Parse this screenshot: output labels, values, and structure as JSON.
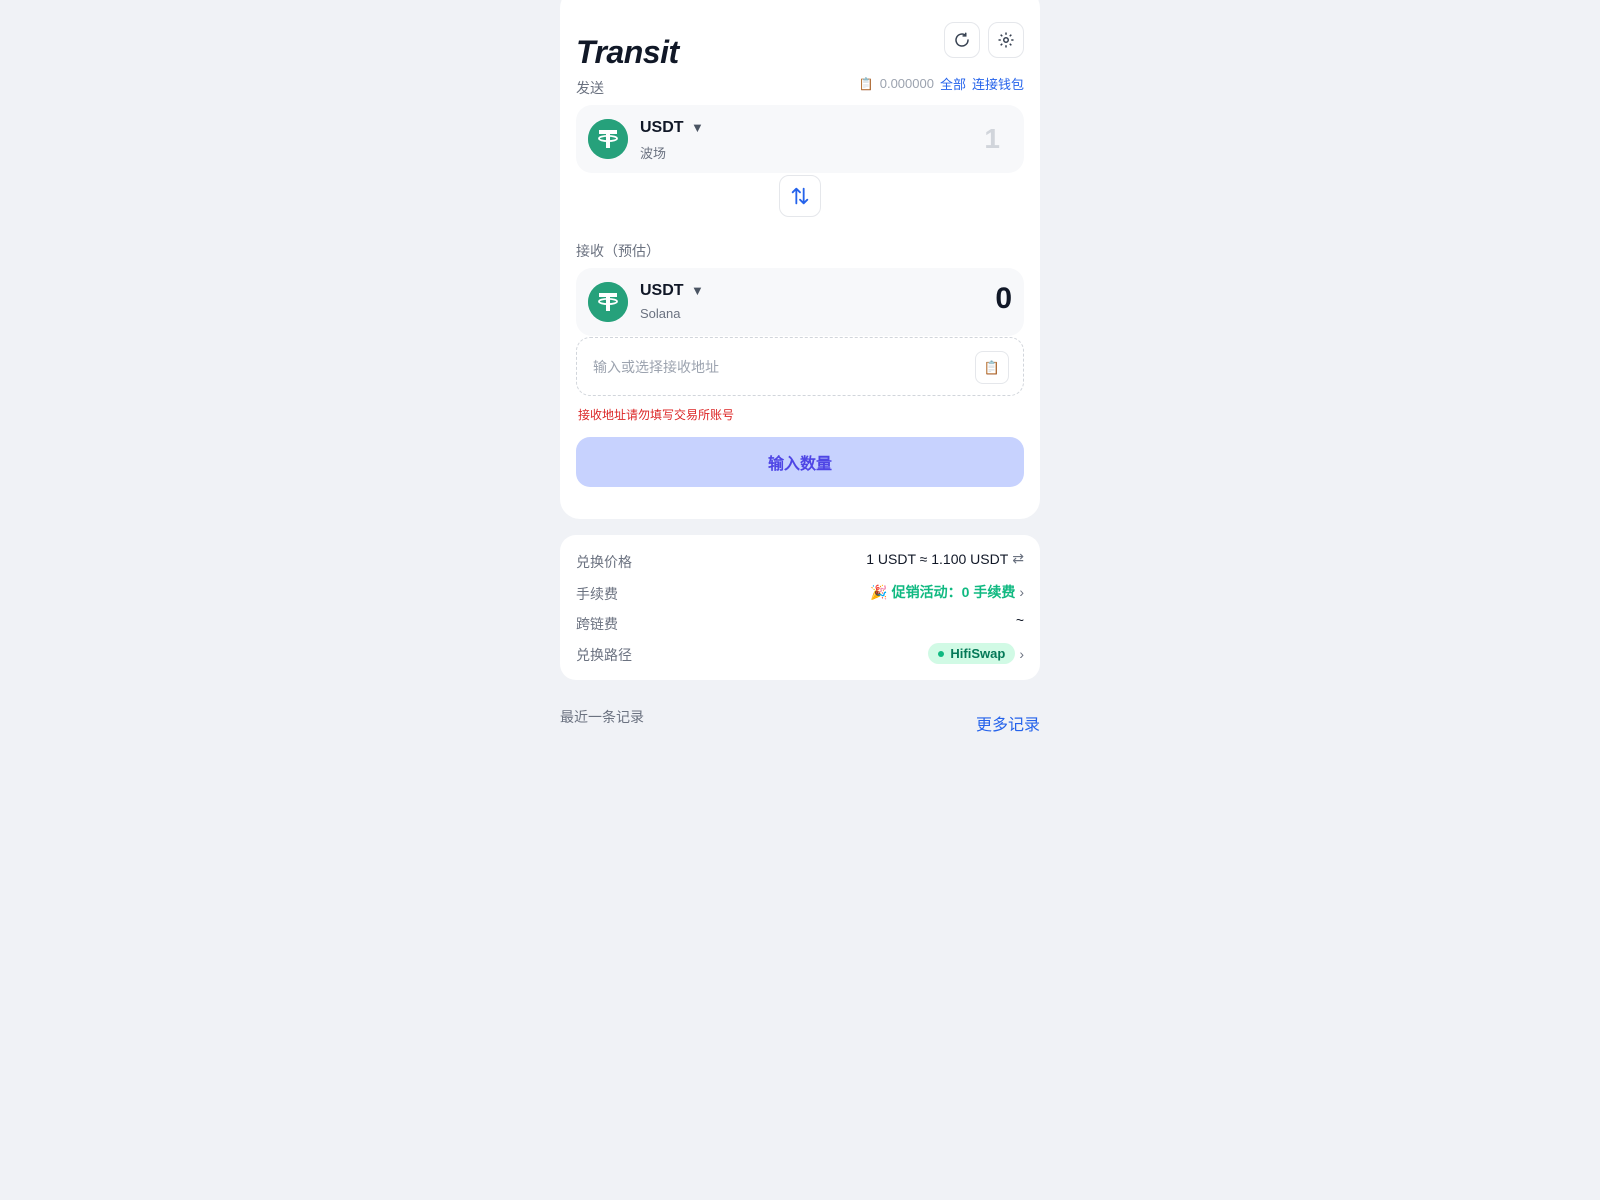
{
  "header": {
    "brand": "Transit",
    "refresh_icon": "refresh-icon",
    "settings_icon": "gear-icon"
  },
  "send": {
    "label": "发送",
    "balance": "0.000000",
    "all_label": "全部",
    "connect_label": "连接钱包",
    "token_symbol": "USDT",
    "chain": "波场",
    "amount_placeholder": "1",
    "amount_value": ""
  },
  "receive": {
    "label": "接收（预估）",
    "token_symbol": "USDT",
    "chain": "Solana",
    "amount": "0"
  },
  "address": {
    "placeholder": "输入或选择接收地址",
    "value": "",
    "warning": "接收地址请勿填写交易所账号"
  },
  "cta": {
    "label": "输入数量"
  },
  "info": {
    "rate_label": "兑换价格",
    "rate_value": "1 USDT ≈ 1.100 USDT",
    "fee_label": "手续费",
    "fee_emoji": "🎉",
    "fee_value": "促销活动：0 手续费",
    "bridge_fee_label": "跨链费",
    "bridge_fee_value": "~",
    "route_label": "兑换路径",
    "route_value": "HifiSwap"
  },
  "history": {
    "recent_label": "最近一条记录",
    "more_label": "更多记录"
  },
  "colors": {
    "accent": "#2563eb",
    "tether_green": "#26a17b",
    "promo_green": "#10b981",
    "warning_red": "#dc2626",
    "cta_bg": "#c7d2fe",
    "cta_text": "#4f46e5"
  }
}
